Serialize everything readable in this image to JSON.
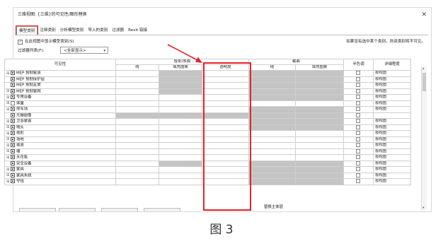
{
  "window": {
    "title": "三维视图: {三维}的可见性/图形替换",
    "close_icon": "close-icon"
  },
  "tabs": [
    "模型类别",
    "注释类别",
    "分析模型类别",
    "导入的类别",
    "过滤器",
    "Revit 链接"
  ],
  "active_tab": 0,
  "options": {
    "show_model_label": "在此视图中显示模型类别(S)",
    "show_model_checked": true,
    "note": "如果没有选中某个类别，则该类别将不可见。",
    "filter_label": "过滤器列表(F):",
    "filter_value": "<全部显示>"
  },
  "table": {
    "col_visibility": "可见性",
    "group_projection": "投影/表面",
    "group_cut": "截面",
    "col_line": "线",
    "col_fill": "填充图案",
    "col_transparency": "透明度",
    "col_halftone": "半色调",
    "col_detail": "详细程度",
    "rows": [
      {
        "name": "MEP 预制管道",
        "checked": true,
        "expand": true,
        "proj_line_shaded": false,
        "proj_fill_shaded": true,
        "cut_shaded": true,
        "halftone": true,
        "detail": "按视图"
      },
      {
        "name": "MEP 预制保护层",
        "checked": true,
        "expand": false,
        "proj_line_shaded": false,
        "proj_fill_shaded": true,
        "cut_shaded": true,
        "halftone": true,
        "detail": "按视图"
      },
      {
        "name": "MEP 预制支架",
        "checked": true,
        "expand": false,
        "proj_line_shaded": false,
        "proj_fill_shaded": true,
        "cut_shaded": true,
        "halftone": true,
        "detail": "按视图"
      },
      {
        "name": "MEP 预制管网",
        "checked": true,
        "expand": true,
        "proj_line_shaded": false,
        "proj_fill_shaded": true,
        "cut_shaded": true,
        "halftone": true,
        "detail": "按视图"
      },
      {
        "name": "专用设备",
        "checked": true,
        "expand": true,
        "proj_line_shaded": false,
        "proj_fill_shaded": false,
        "cut_shaded": true,
        "halftone": true,
        "detail": "按视图"
      },
      {
        "name": "体量",
        "checked": false,
        "expand": true,
        "proj_line_shaded": false,
        "proj_fill_shaded": false,
        "cut_shaded": false,
        "halftone": true,
        "detail": "按视图"
      },
      {
        "name": "停车场",
        "checked": true,
        "expand": true,
        "proj_line_shaded": false,
        "proj_fill_shaded": false,
        "cut_shaded": true,
        "halftone": true,
        "detail": "按视图"
      },
      {
        "name": "光栅图像",
        "checked": true,
        "expand": false,
        "proj_line_shaded": true,
        "proj_fill_shaded": true,
        "cut_shaded": true,
        "halftone": true,
        "detail": ""
      },
      {
        "name": "卫浴装置",
        "checked": true,
        "expand": true,
        "proj_line_shaded": false,
        "proj_fill_shaded": false,
        "cut_shaded": true,
        "halftone": true,
        "detail": "按视图"
      },
      {
        "name": "喷头",
        "checked": true,
        "expand": true,
        "proj_line_shaded": false,
        "proj_fill_shaded": false,
        "cut_shaded": true,
        "halftone": true,
        "detail": "按视图"
      },
      {
        "name": "地形",
        "checked": true,
        "expand": true,
        "proj_line_shaded": false,
        "proj_fill_shaded": false,
        "cut_shaded": false,
        "halftone": true,
        "detail": "按视图"
      },
      {
        "name": "场地",
        "checked": true,
        "expand": true,
        "proj_line_shaded": false,
        "proj_fill_shaded": false,
        "cut_shaded": false,
        "halftone": true,
        "detail": "按视图"
      },
      {
        "name": "坡道",
        "checked": true,
        "expand": true,
        "proj_line_shaded": false,
        "proj_fill_shaded": false,
        "cut_shaded": false,
        "halftone": true,
        "detail": "按视图"
      },
      {
        "name": "墙",
        "checked": true,
        "expand": true,
        "proj_line_shaded": false,
        "proj_fill_shaded": false,
        "cut_shaded": false,
        "halftone": true,
        "detail": "按视图"
      },
      {
        "name": "天花板",
        "checked": true,
        "expand": true,
        "proj_line_shaded": false,
        "proj_fill_shaded": false,
        "cut_shaded": false,
        "halftone": true,
        "detail": "按视图"
      },
      {
        "name": "安全设备",
        "checked": true,
        "expand": false,
        "proj_line_shaded": false,
        "proj_fill_shaded": true,
        "cut_shaded": true,
        "halftone": true,
        "detail": "按视图"
      },
      {
        "name": "家具",
        "checked": true,
        "expand": true,
        "proj_line_shaded": false,
        "proj_fill_shaded": false,
        "cut_shaded": true,
        "halftone": true,
        "detail": "按视图"
      },
      {
        "name": "家具系统",
        "checked": true,
        "expand": true,
        "proj_line_shaded": false,
        "proj_fill_shaded": false,
        "cut_shaded": true,
        "halftone": true,
        "detail": "按视图"
      },
      {
        "name": "导线",
        "checked": true,
        "expand": true,
        "proj_line_shaded": false,
        "proj_fill_shaded": false,
        "cut_shaded": true,
        "halftone": true,
        "detail": "按视图"
      }
    ]
  },
  "bottom_label": "替换主体层",
  "caption": "图 3",
  "colors": {
    "highlight": "#e2252a",
    "shaded_cell": "#c4c4c4"
  }
}
